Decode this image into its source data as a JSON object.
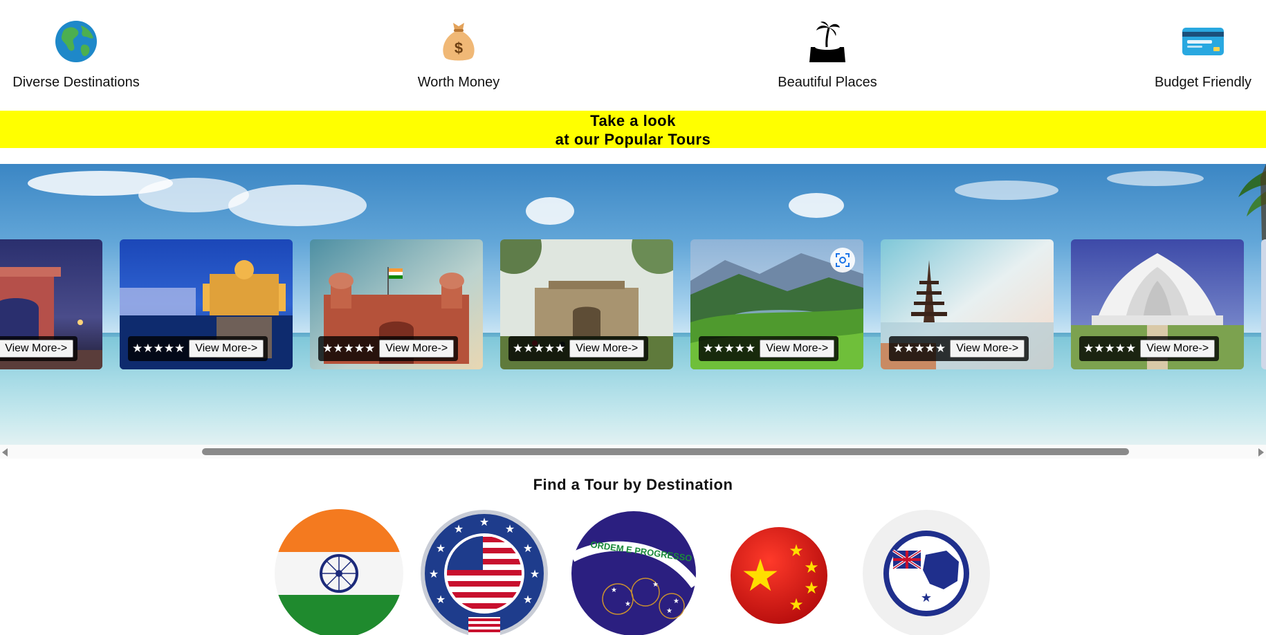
{
  "features": [
    {
      "icon": "globe-icon",
      "label": "Diverse Destinations"
    },
    {
      "icon": "money-bag-icon",
      "label": "Worth Money"
    },
    {
      "icon": "island-icon",
      "label": "Beautiful Places"
    },
    {
      "icon": "credit-card-icon",
      "label": "Budget Friendly"
    }
  ],
  "banner": {
    "line1": "Take a look",
    "line2": "at our Popular Tours"
  },
  "tours": [
    {
      "scene": "india-gate",
      "rating": "★★★★★",
      "button": "View More->"
    },
    {
      "scene": "golden-temple",
      "rating": "★★★★★",
      "button": "View More->"
    },
    {
      "scene": "red-fort",
      "rating": "★★★★★",
      "button": "View More->"
    },
    {
      "scene": "heritage-ruins",
      "rating": "★★★★★",
      "button": "View More->"
    },
    {
      "scene": "tea-hills",
      "rating": "★★★★★",
      "button": "View More->"
    },
    {
      "scene": "bali-temple",
      "rating": "★★★★★",
      "button": "View More->"
    },
    {
      "scene": "lotus-temple",
      "rating": "★★★★★",
      "button": "View More->"
    }
  ],
  "destinations": {
    "title": "Find a Tour by Destination",
    "flags": [
      "india-flag",
      "usa-flag",
      "brazil-flag",
      "china-flag",
      "australia-flag"
    ]
  },
  "colors": {
    "banner": "#ffff00",
    "scroll_thumb": "#8a8a8a"
  }
}
